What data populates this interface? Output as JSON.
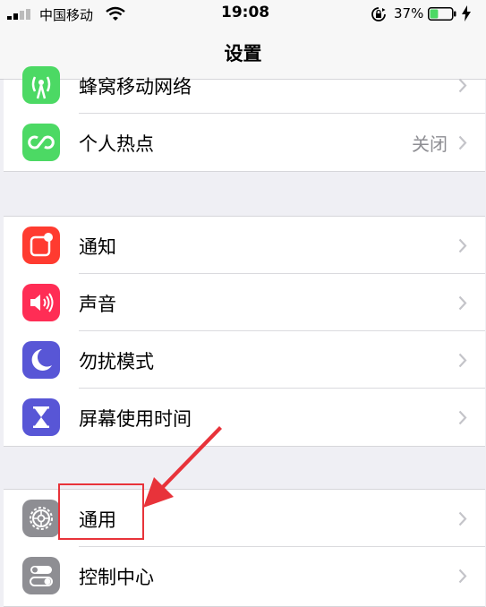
{
  "status_bar": {
    "carrier": "中国移动",
    "time": "19:08",
    "battery_percent": "37%",
    "battery_level": 0.37
  },
  "nav": {
    "title": "设置"
  },
  "groups": [
    {
      "rows": [
        {
          "label": "蜂窝移动网络",
          "icon": "antenna-icon",
          "color": "#4cd964"
        },
        {
          "label": "个人热点",
          "detail": "关闭",
          "icon": "hotspot-icon",
          "color": "#4cd964"
        }
      ]
    },
    {
      "rows": [
        {
          "label": "通知",
          "icon": "notification-icon",
          "color": "#ff3b30"
        },
        {
          "label": "声音",
          "icon": "speaker-icon",
          "color": "#ff2d55"
        },
        {
          "label": "勿扰模式",
          "icon": "moon-icon",
          "color": "#5856d6"
        },
        {
          "label": "屏幕使用时间",
          "icon": "hourglass-icon",
          "color": "#5856d6"
        }
      ]
    },
    {
      "rows": [
        {
          "label": "通用",
          "icon": "gear-icon",
          "color": "#8e8e93"
        },
        {
          "label": "控制中心",
          "icon": "toggles-icon",
          "color": "#8e8e93"
        }
      ]
    }
  ],
  "annotation": {
    "color": "#e8333a"
  }
}
